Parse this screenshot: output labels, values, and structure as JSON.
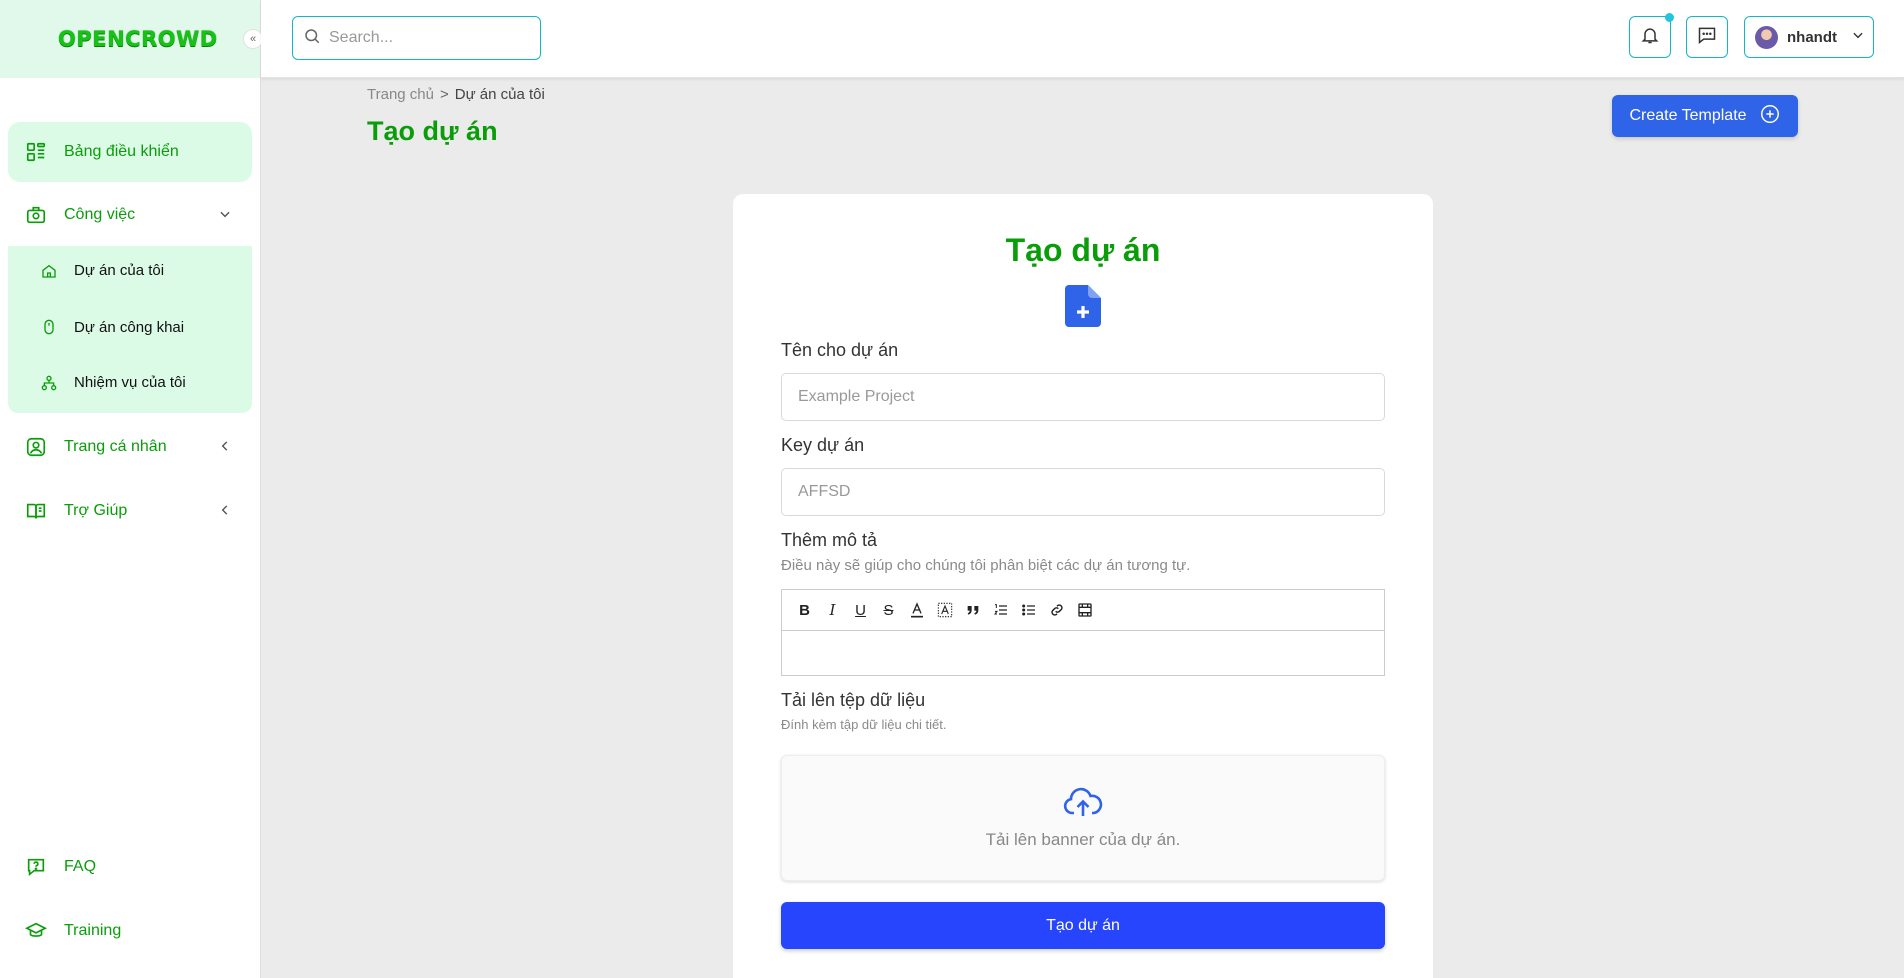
{
  "brand": {
    "logo_text": "OPENCROWD",
    "color": "#0a9d0a"
  },
  "sidebar": {
    "collapse_glyph": "«",
    "items": [
      {
        "label": "Bảng điều khiển",
        "icon": "dashboard-icon",
        "active": true
      },
      {
        "label": "Công việc",
        "icon": "briefcase-icon",
        "expanded": true
      },
      {
        "label": "Trang cá nhân",
        "icon": "profile-icon"
      },
      {
        "label": "Trợ Giúp",
        "icon": "book-icon"
      }
    ],
    "sub_items": [
      {
        "label": "Dự án của tôi",
        "icon": "home-icon"
      },
      {
        "label": "Dự án công khai",
        "icon": "mouse-icon"
      },
      {
        "label": "Nhiệm vụ của tôi",
        "icon": "network-icon"
      }
    ],
    "bottom_items": [
      {
        "label": "FAQ",
        "icon": "question-bubble-icon"
      },
      {
        "label": "Training",
        "icon": "graduation-cap-icon"
      }
    ]
  },
  "header": {
    "search_placeholder": "Search...",
    "username": "nhandt",
    "notification_dot": true
  },
  "breadcrumb": {
    "home": "Trang chủ",
    "separator": ">",
    "current": "Dự án của tôi"
  },
  "page_title": "Tạo dự án",
  "create_template_label": "Create Template",
  "form": {
    "title": "Tạo dự án",
    "name_label": "Tên cho dự án",
    "name_placeholder": "Example Project",
    "key_label": "Key dự án",
    "key_placeholder": "AFFSD",
    "desc_label": "Thêm mô tả",
    "desc_hint": "Điều này sẽ giúp cho chúng tôi phân biệt các dự án tương tự.",
    "toolbar": [
      "bold-icon",
      "italic-icon",
      "underline-icon",
      "strikethrough-icon",
      "text-color-icon",
      "highlight-icon",
      "quote-icon",
      "ordered-list-icon",
      "bullet-list-icon",
      "link-icon",
      "video-icon"
    ],
    "upload_label": "Tải lên tệp dữ liệu",
    "upload_hint": "Đính kèm tập dữ liệu chi tiết.",
    "upload_text": "Tải lên banner của dự án.",
    "submit_label": "Tạo dự án"
  },
  "colors": {
    "accent_blue": "#2f64e8",
    "submit_blue": "#2645fc",
    "cyan_border": "#12b8c9",
    "sidebar_active_bg": "#dcfbe6"
  }
}
